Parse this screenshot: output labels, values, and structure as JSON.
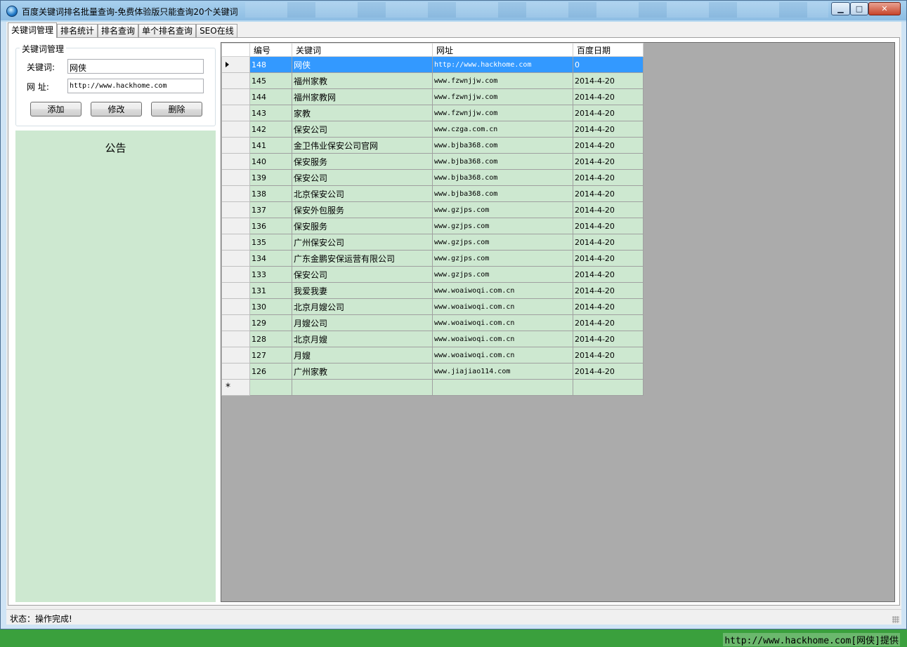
{
  "window": {
    "title": "百度关键词排名批量查询-免费体验版只能查询20个关键词",
    "minimize_glyph": "▁",
    "maximize_glyph": "□",
    "close_glyph": "✕"
  },
  "tabs": [
    {
      "label": "关键词管理",
      "active": true
    },
    {
      "label": "排名统计",
      "active": false
    },
    {
      "label": "排名查询",
      "active": false
    },
    {
      "label": "单个排名查询",
      "active": false
    },
    {
      "label": "SEO在线",
      "active": false
    }
  ],
  "keyword_group": {
    "legend": "关键词管理",
    "keyword_label": "关键词:",
    "keyword_value": "网侠",
    "url_label": "网 址:",
    "url_value": "http://www.hackhome.com",
    "add_label": "添加",
    "edit_label": "修改",
    "delete_label": "删除"
  },
  "notice": {
    "title": "公告"
  },
  "grid": {
    "columns": [
      "编号",
      "关键词",
      "网址",
      "百度日期"
    ],
    "rows": [
      {
        "id": "148",
        "keyword": "网侠",
        "url": "http://www.hackhome.com",
        "date": "0",
        "selected": true
      },
      {
        "id": "145",
        "keyword": "福州家教",
        "url": "www.fzwnjjw.com",
        "date": "2014-4-20"
      },
      {
        "id": "144",
        "keyword": "福州家教网",
        "url": "www.fzwnjjw.com",
        "date": "2014-4-20"
      },
      {
        "id": "143",
        "keyword": "家教",
        "url": "www.fzwnjjw.com",
        "date": "2014-4-20"
      },
      {
        "id": "142",
        "keyword": "保安公司",
        "url": "www.czga.com.cn",
        "date": "2014-4-20"
      },
      {
        "id": "141",
        "keyword": "金卫伟业保安公司官网",
        "url": "www.bjba368.com",
        "date": "2014-4-20"
      },
      {
        "id": "140",
        "keyword": "保安服务",
        "url": "www.bjba368.com",
        "date": "2014-4-20"
      },
      {
        "id": "139",
        "keyword": "保安公司",
        "url": "www.bjba368.com",
        "date": "2014-4-20"
      },
      {
        "id": "138",
        "keyword": "北京保安公司",
        "url": "www.bjba368.com",
        "date": "2014-4-20"
      },
      {
        "id": "137",
        "keyword": "保安外包服务",
        "url": "www.gzjps.com",
        "date": "2014-4-20"
      },
      {
        "id": "136",
        "keyword": "保安服务",
        "url": "www.gzjps.com",
        "date": "2014-4-20"
      },
      {
        "id": "135",
        "keyword": "广州保安公司",
        "url": "www.gzjps.com",
        "date": "2014-4-20"
      },
      {
        "id": "134",
        "keyword": "广东金鹏安保运营有限公司",
        "url": "www.gzjps.com",
        "date": "2014-4-20"
      },
      {
        "id": "133",
        "keyword": "保安公司",
        "url": "www.gzjps.com",
        "date": "2014-4-20"
      },
      {
        "id": "131",
        "keyword": "我爱我妻",
        "url": "www.woaiwoqi.com.cn",
        "date": "2014-4-20"
      },
      {
        "id": "130",
        "keyword": "北京月嫂公司",
        "url": "www.woaiwoqi.com.cn",
        "date": "2014-4-20"
      },
      {
        "id": "129",
        "keyword": "月嫂公司",
        "url": "www.woaiwoqi.com.cn",
        "date": "2014-4-20"
      },
      {
        "id": "128",
        "keyword": "北京月嫂",
        "url": "www.woaiwoqi.com.cn",
        "date": "2014-4-20"
      },
      {
        "id": "127",
        "keyword": "月嫂",
        "url": "www.woaiwoqi.com.cn",
        "date": "2014-4-20"
      },
      {
        "id": "126",
        "keyword": "广州家教",
        "url": "www.jiajiao114.com",
        "date": "2014-4-20"
      }
    ],
    "new_row_glyph": "*",
    "selected_color": "#3399ff",
    "cell_color": "#cde8d0"
  },
  "status": {
    "text": "状态：操作完成!"
  },
  "footer": {
    "text": "http://www.hackhome.com[网侠]提供"
  }
}
